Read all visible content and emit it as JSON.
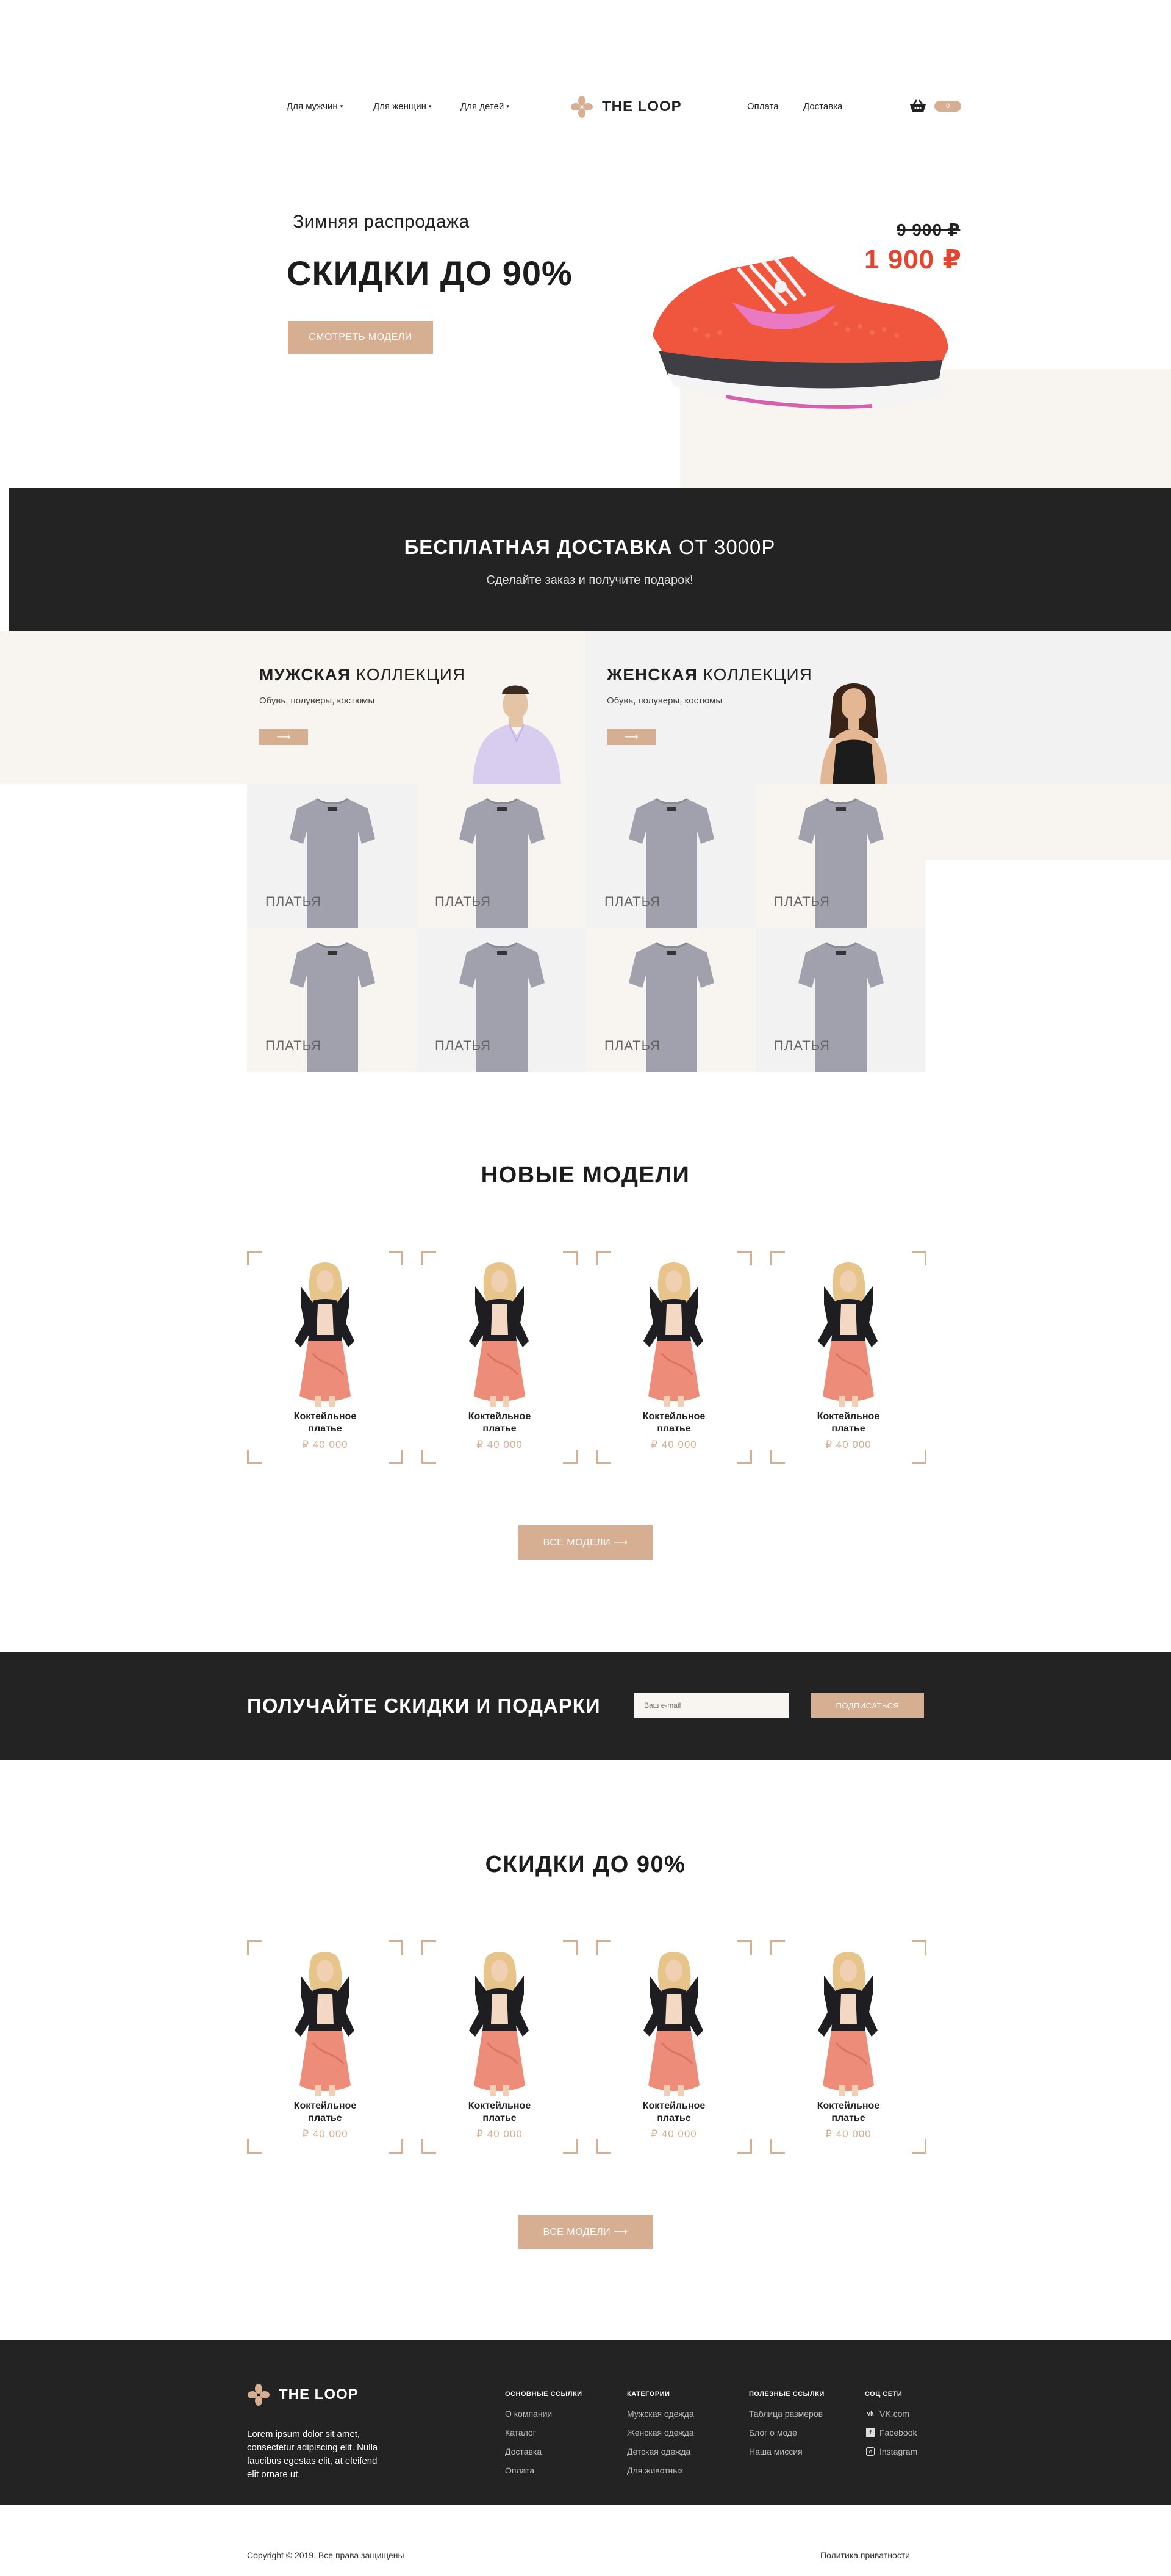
{
  "header": {
    "nav_left": [
      {
        "label": "Для мужчин"
      },
      {
        "label": "Для женщин"
      },
      {
        "label": "Для детей"
      }
    ],
    "logo_text": "THE LOOP",
    "nav_right": [
      {
        "label": "Оплата"
      },
      {
        "label": "Доставка"
      }
    ],
    "cart_count": "0"
  },
  "hero": {
    "subtitle": "Зимняя распродажа",
    "title": "СКИДКИ ДО 90%",
    "button": "СМОТРЕТЬ МОДЕЛИ",
    "price_old": "9 900 ₽",
    "price_new": "1 900 ₽"
  },
  "delivery": {
    "title_bold": "БЕСПЛАТНАЯ ДОСТАВКА",
    "title_light": " ОТ 3000Р",
    "subtitle": "Сделайте заказ и получите подарок!"
  },
  "collections": [
    {
      "title_bold": "МУЖСКАЯ",
      "title_light": " КОЛЛЕКЦИЯ",
      "desc": "Обувь, полуверы, костюмы",
      "arrow": "⟶"
    },
    {
      "title_bold": "ЖЕНСКАЯ",
      "title_light": " КОЛЛЕКЦИЯ",
      "desc": "Обувь, полуверы, костюмы",
      "arrow": "⟶"
    }
  ],
  "categories": [
    {
      "label": "ПЛАТЬЯ"
    },
    {
      "label": "ПЛАТЬЯ"
    },
    {
      "label": "ПЛАТЬЯ"
    },
    {
      "label": "ПЛАТЬЯ"
    },
    {
      "label": "ПЛАТЬЯ"
    },
    {
      "label": "ПЛАТЬЯ"
    },
    {
      "label": "ПЛАТЬЯ"
    },
    {
      "label": "ПЛАТЬЯ"
    }
  ],
  "new_models": {
    "title": "НОВЫЕ МОДЕЛИ",
    "products": [
      {
        "name": "Коктейльное платье",
        "price": "₽ 40 000"
      },
      {
        "name": "Коктейльное платье",
        "price": "₽ 40 000"
      },
      {
        "name": "Коктейльное платье",
        "price": "₽ 40 000"
      },
      {
        "name": "Коктейльное платье",
        "price": "₽ 40 000"
      }
    ],
    "button": "ВСЕ МОДЕЛИ  ⟶"
  },
  "subscribe": {
    "title": "ПОЛУЧАЙТЕ СКИДКИ И ПОДАРКИ",
    "placeholder": "Ваш e-mail",
    "button": "ПОДПИСАТЬСЯ"
  },
  "sale": {
    "title": "СКИДКИ ДО 90%",
    "products": [
      {
        "name": "Коктейльное платье",
        "price": "₽ 40 000"
      },
      {
        "name": "Коктейльное платье",
        "price": "₽ 40 000"
      },
      {
        "name": "Коктейльное платье",
        "price": "₽ 40 000"
      },
      {
        "name": "Коктейльное платье",
        "price": "₽ 40 000"
      }
    ],
    "button": "ВСЕ МОДЕЛИ  ⟶"
  },
  "footer": {
    "logo_text": "THE LOOP",
    "about": "Lorem ipsum dolor sit amet, consectetur adipiscing elit. Nulla faucibus egestas elit, at eleifend elit ornare ut.",
    "columns": [
      {
        "title": "ОСНОВНЫЕ ССЫЛКИ",
        "links": [
          "О компании",
          "Каталог",
          "Доставка",
          "Оплата"
        ]
      },
      {
        "title": "КАТЕГОРИИ",
        "links": [
          "Мужская одежда",
          "Женская одежда",
          "Детская одежда",
          "Для животных"
        ]
      },
      {
        "title": "ПОЛЕЗНЫЕ ССЫЛКИ",
        "links": [
          "Таблица размеров",
          "Блог о моде",
          "Наша миссия"
        ]
      }
    ],
    "social_title": "СОЦ СЕТИ",
    "social": [
      {
        "icon": "vk-icon",
        "label": "VK.com"
      },
      {
        "icon": "facebook-icon",
        "label": "Facebook"
      },
      {
        "icon": "instagram-icon",
        "label": "Instagram"
      }
    ],
    "copyright": "Copyright © 2019. Все права защищены",
    "privacy": "Политика приватности"
  },
  "colors": {
    "accent": "#d6ae91",
    "dark": "#232323",
    "sale_red": "#e3452f",
    "cream": "#f8f4ef",
    "grey_bg": "#f2f2f3"
  }
}
